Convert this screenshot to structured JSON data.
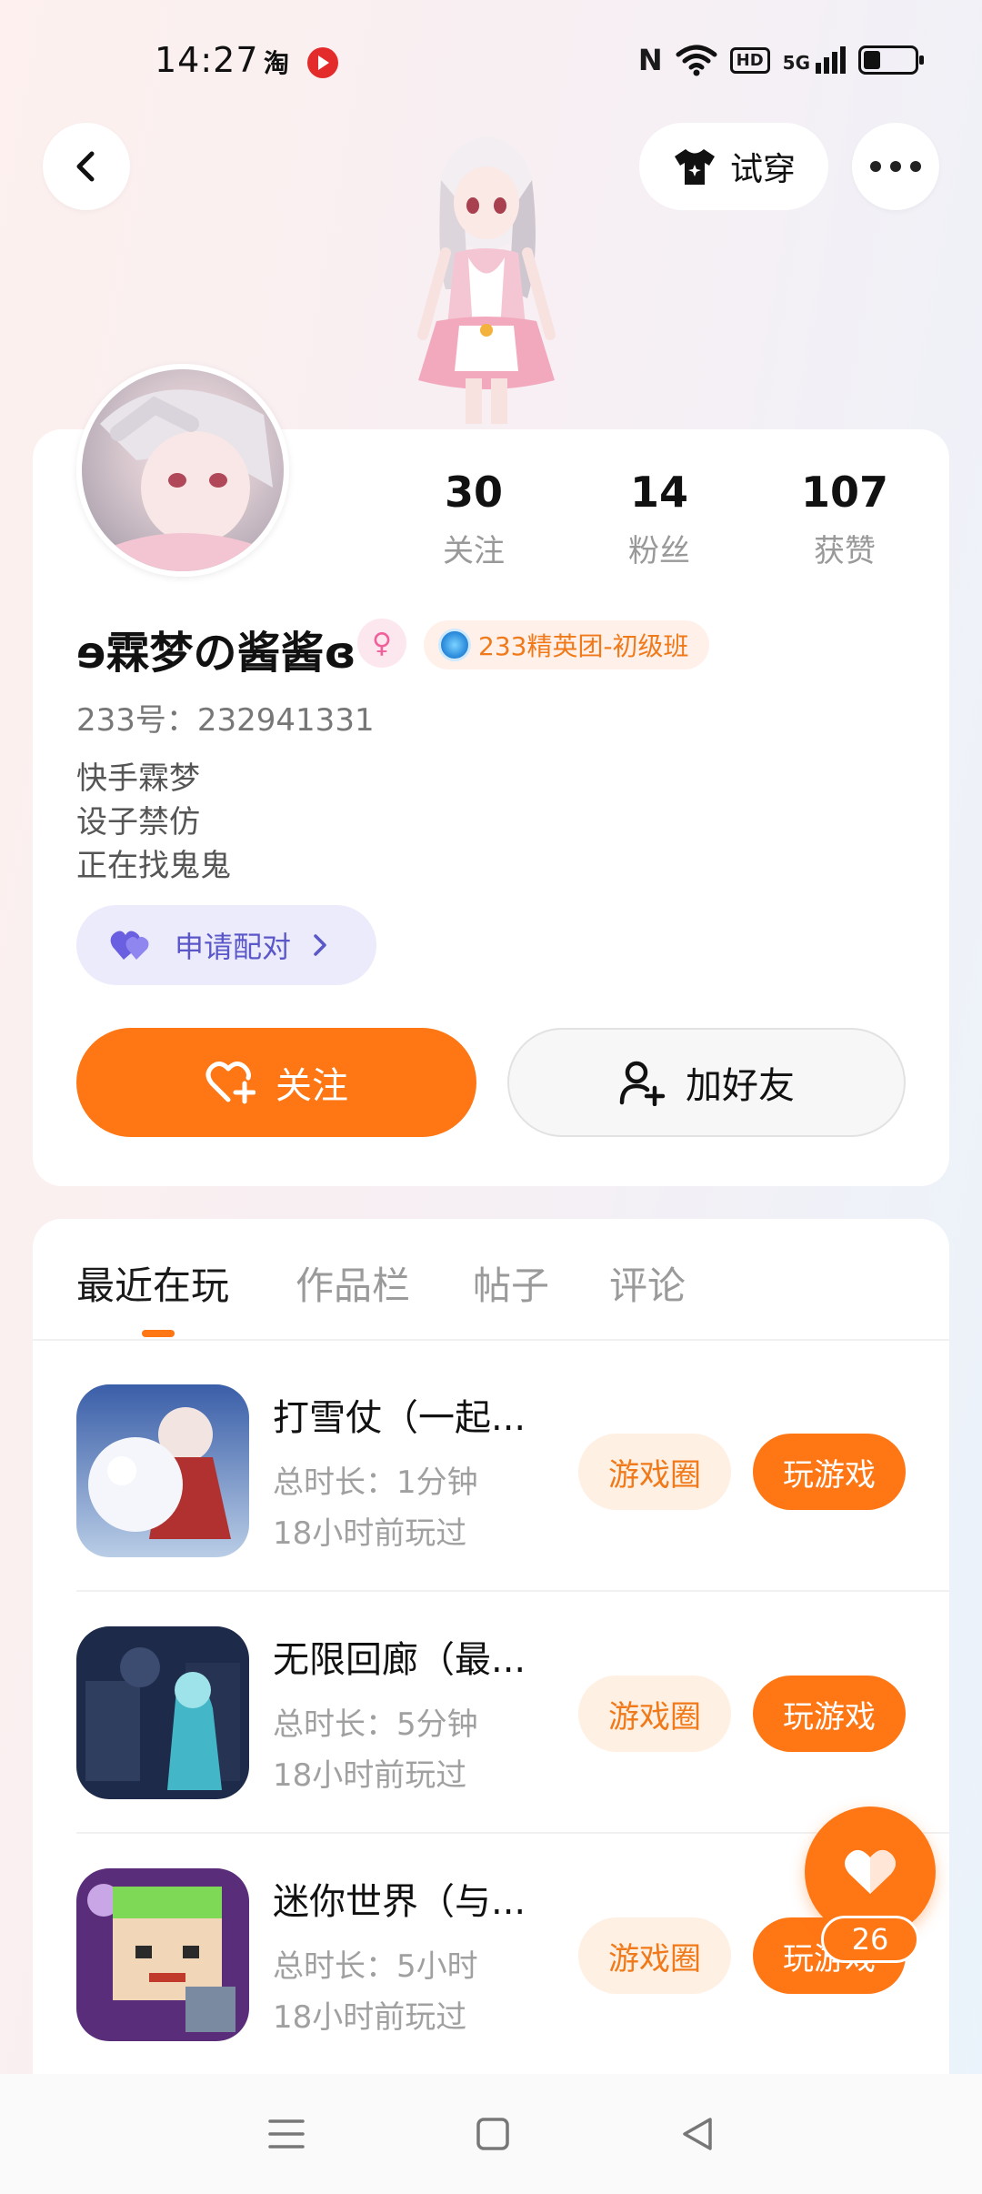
{
  "status_bar": {
    "time": "14:27",
    "app_icon_1": "淘",
    "nfc_icon": "N",
    "hd_label": "HD",
    "network_label": "5G"
  },
  "header": {
    "tryon_label": "试穿"
  },
  "profile": {
    "stats": [
      {
        "value": "30",
        "label": "关注"
      },
      {
        "value": "14",
        "label": "粉丝"
      },
      {
        "value": "107",
        "label": "获赞"
      }
    ],
    "username": "ɘ霖梦の酱酱ɞ",
    "gender_symbol": "♀",
    "rank_badge": "233精英团-初级班",
    "uid": "233号：232941331",
    "bio": [
      "快手霖梦",
      "设子禁仿",
      "正在找鬼鬼"
    ],
    "pair_button": "申请配对",
    "follow_button": "关注",
    "add_friend_button": "加好友"
  },
  "tabs": [
    {
      "label": "最近在玩",
      "active": true
    },
    {
      "label": "作品栏",
      "active": false
    },
    {
      "label": "帖子",
      "active": false
    },
    {
      "label": "评论",
      "active": false
    }
  ],
  "games": [
    {
      "title": "打雪仗（一起...",
      "duration": "总时长：1分钟",
      "last_played": "18小时前玩过",
      "circle_button": "游戏圈",
      "play_button": "玩游戏"
    },
    {
      "title": "无限回廊（最...",
      "duration": "总时长：5分钟",
      "last_played": "18小时前玩过",
      "circle_button": "游戏圈",
      "play_button": "玩游戏"
    },
    {
      "title": "迷你世界（与...",
      "duration": "总时长：5小时",
      "last_played": "18小时前玩过",
      "circle_button": "游戏圈",
      "play_button": "玩游戏"
    }
  ],
  "floating_like": {
    "count": "26"
  },
  "colors": {
    "accent": "#ff7614",
    "pair_purple": "#5a57c9",
    "rank_orange": "#f07a1a",
    "muted_text": "#9a9a9a"
  }
}
